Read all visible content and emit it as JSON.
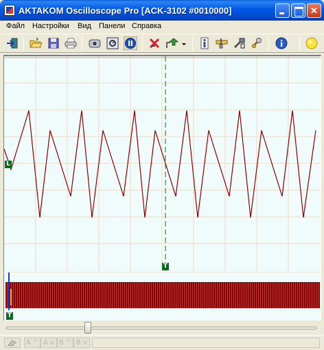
{
  "window": {
    "title": "AKTAKOM Oscilloscope Pro [ACK-3102 #0010000]"
  },
  "menu": {
    "items": [
      "Файл",
      "Настройки",
      "Вид",
      "Панели",
      "Справка"
    ]
  },
  "toolbar": {
    "icons": [
      "exit-icon",
      "open-folder-icon",
      "save-icon",
      "print-icon",
      "camera-icon",
      "snapshot-icon",
      "pause-icon",
      "stop-icon",
      "export-icon",
      "dropdown-arrow-icon",
      "info-file-icon",
      "ruler-icon",
      "tools-icon",
      "settings-icon",
      "help-icon",
      "status-lamp-icon"
    ]
  },
  "scope": {
    "trace_color": "#8b0000",
    "grid_color": "#f5d9c3",
    "background": "#f0fbfb",
    "trigger_line_color": "#1d6b2a",
    "trigger_marker_label": "T",
    "level_marker_label": "L",
    "waveform": "triangle-sawtooth",
    "peak_count_visible": 8
  },
  "overview": {
    "marker_label": "T"
  },
  "statusbar": {
    "cells": [
      "A ^",
      "A v",
      "B ^",
      "B v"
    ]
  }
}
